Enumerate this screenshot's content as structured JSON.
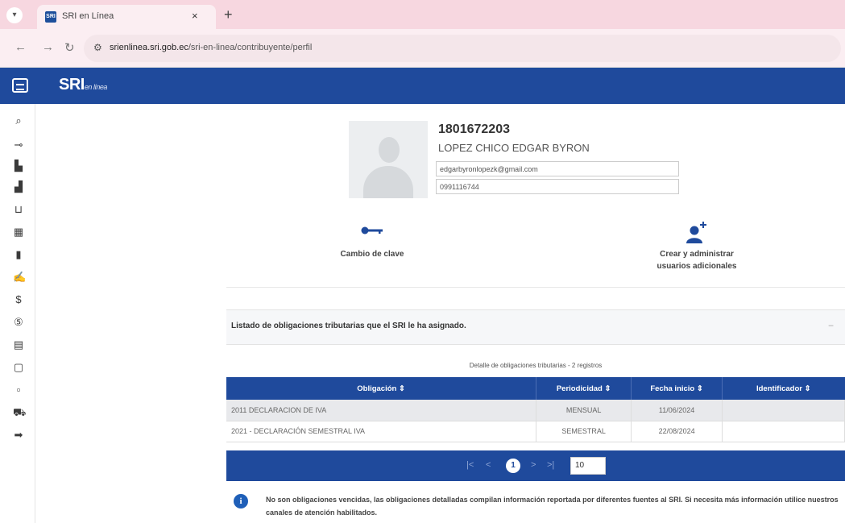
{
  "browser": {
    "tab_title": "SRI en Línea",
    "favicon_text": "SRI",
    "tab_close": "×",
    "new_tab": "+",
    "url_host": "srienlinea.sri.gob.ec",
    "url_path": "/sri-en-linea/contribuyente/perfil"
  },
  "app": {
    "logo": "SRI",
    "logo_sub": "en línea",
    "brand_color": "#1f4a9c"
  },
  "sidebar_icons": [
    "search-icon",
    "key-icon",
    "building-icon",
    "factory-icon",
    "inbox-icon",
    "calculator-icon",
    "document-icon",
    "handshake-icon",
    "dollar-icon",
    "coin-icon",
    "barcode-icon",
    "form-icon",
    "file-icon",
    "car-icon",
    "arrow-right-icon"
  ],
  "profile": {
    "ruc": "1801672203",
    "name": "LOPEZ CHICO EDGAR BYRON",
    "email": "edgarbyronlopezk@gmail.com",
    "phone": "0991116744"
  },
  "actions": {
    "change_password": "Cambio de clave",
    "create_users_line1": "Crear y administrar",
    "create_users_line2": "usuarios adicionales"
  },
  "obligations": {
    "panel_title": "Listado de obligaciones tributarias que el SRI le ha asignado.",
    "toggle": "−",
    "caption": "Detalle de obligaciones tributarias - 2 registros",
    "headers": {
      "obligation": "Obligación ⇕",
      "period": "Periodicidad ⇕",
      "start": "Fecha inicio ⇕",
      "id": "Identificador ⇕"
    },
    "rows": [
      {
        "obligation": "2011 DECLARACION DE IVA",
        "period": "MENSUAL",
        "start": "11/06/2024",
        "id": ""
      },
      {
        "obligation": "2021 - DECLARACIÓN SEMESTRAL IVA",
        "period": "SEMESTRAL",
        "start": "22/08/2024",
        "id": ""
      }
    ]
  },
  "pager": {
    "first": "|<",
    "prev": "<",
    "current": "1",
    "next": ">",
    "last": ">|",
    "page_size": "10"
  },
  "info": {
    "text": "No son obligaciones vencidas, las obligaciones detalladas compilan información reportada por diferentes fuentes al SRI. Si necesita más información utilice nuestros canales de atención habilitados."
  }
}
